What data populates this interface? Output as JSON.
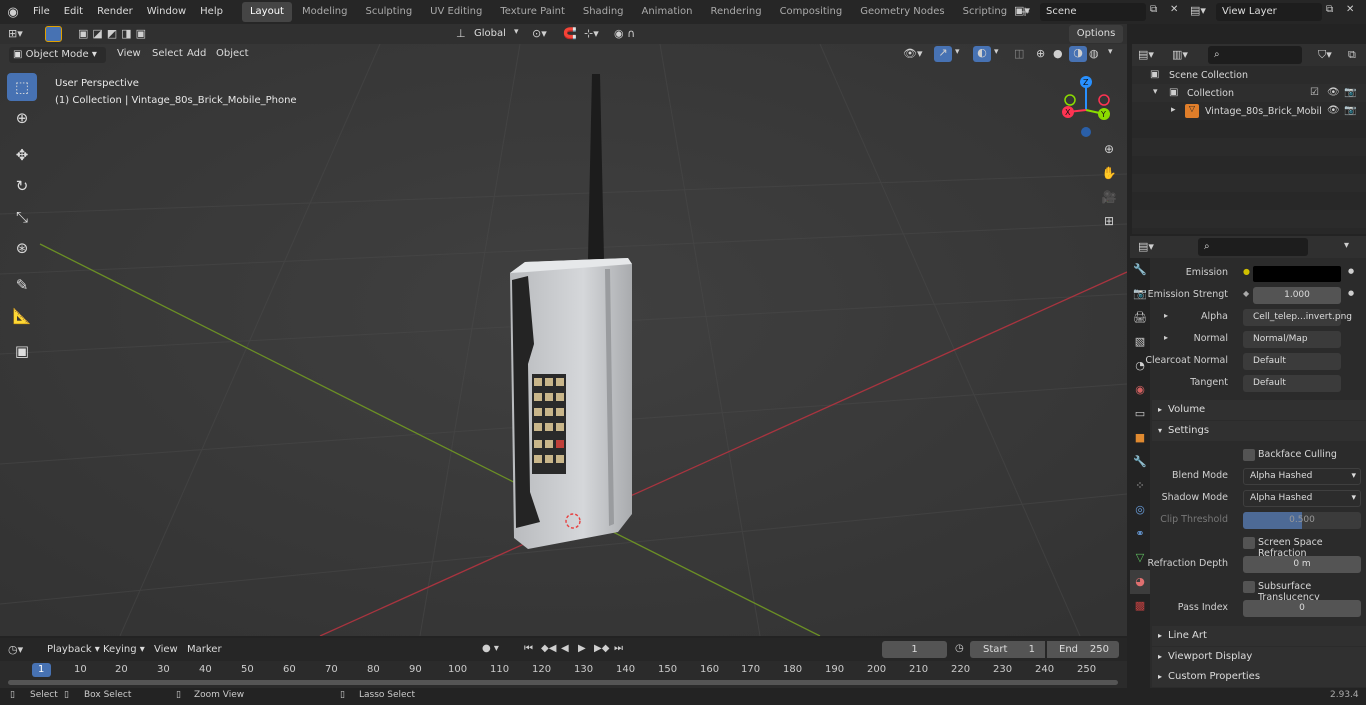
{
  "topbar": {
    "menus": [
      "File",
      "Edit",
      "Render",
      "Window",
      "Help"
    ],
    "workspaces": [
      "Layout",
      "Modeling",
      "Sculpting",
      "UV Editing",
      "Texture Paint",
      "Shading",
      "Animation",
      "Rendering",
      "Compositing",
      "Geometry Nodes",
      "Scripting"
    ],
    "scene": "Scene",
    "view_layer": "View Layer"
  },
  "viewport": {
    "mode": "Object Mode",
    "menus": [
      "View",
      "Select",
      "Add",
      "Object"
    ],
    "transform": "Global",
    "options": "Options",
    "info_line1": "User Perspective",
    "info_line2": "(1) Collection | Vintage_80s_Brick_Mobile_Phone",
    "gizmo": {
      "x": "X",
      "y": "Y",
      "z": "Z"
    }
  },
  "outliner": {
    "scene_collection": "Scene Collection",
    "collection": "Collection",
    "object": "Vintage_80s_Brick_Mobil"
  },
  "properties": {
    "rows": [
      {
        "label": "Emission",
        "value": ""
      },
      {
        "label": "Emission Strengt",
        "value": "1.000"
      },
      {
        "label": "Alpha",
        "value": "Cell_telep...invert.png"
      },
      {
        "label": "Normal",
        "value": "Normal/Map"
      },
      {
        "label": "Clearcoat Normal",
        "value": "Default"
      },
      {
        "label": "Tangent",
        "value": "Default"
      }
    ],
    "sections": {
      "volume": "Volume",
      "settings": "Settings",
      "line_art": "Line Art",
      "viewport_display": "Viewport Display",
      "custom_properties": "Custom Properties"
    },
    "settings": {
      "backface": "Backface Culling",
      "blend_label": "Blend Mode",
      "blend_value": "Alpha Hashed",
      "shadow_label": "Shadow Mode",
      "shadow_value": "Alpha Hashed",
      "clip_label": "Clip Threshold",
      "clip_value": "0.500",
      "ssr": "Screen Space Refraction",
      "refraction_label": "Refraction Depth",
      "refraction_value": "0 m",
      "sss": "Subsurface Translucency",
      "pass_label": "Pass Index",
      "pass_value": "0"
    }
  },
  "timeline": {
    "menus": [
      "Playback",
      "Keying",
      "View",
      "Marker"
    ],
    "current_frame": "1",
    "start_label": "Start",
    "start": "1",
    "end_label": "End",
    "end": "250",
    "ticks": [
      "1",
      "10",
      "20",
      "30",
      "40",
      "50",
      "60",
      "70",
      "80",
      "90",
      "100",
      "110",
      "120",
      "130",
      "140",
      "150",
      "160",
      "170",
      "180",
      "190",
      "200",
      "210",
      "220",
      "230",
      "240",
      "250"
    ]
  },
  "status": {
    "select": "Select",
    "box_select": "Box Select",
    "zoom_view": "Zoom View",
    "lasso_select": "Lasso Select",
    "version": "2.93.4"
  },
  "colors": {
    "accent": "#4772b3",
    "x_axis": "#ff3352",
    "y_axis": "#8bdc00",
    "z_axis": "#2890ff",
    "active_tab": "#454545"
  }
}
